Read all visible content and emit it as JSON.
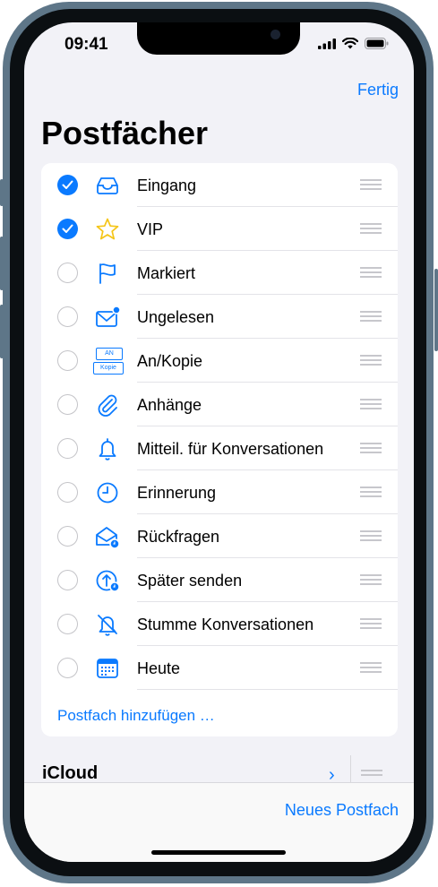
{
  "status_bar": {
    "time": "09:41"
  },
  "header": {
    "done_label": "Fertig",
    "title": "Postfächer"
  },
  "mailboxes": [
    {
      "label": "Eingang",
      "checked": true,
      "icon": "inbox-tray-icon"
    },
    {
      "label": "VIP",
      "checked": true,
      "icon": "star-icon"
    },
    {
      "label": "Markiert",
      "checked": false,
      "icon": "flag-icon"
    },
    {
      "label": "Ungelesen",
      "checked": false,
      "icon": "unread-envelope-icon"
    },
    {
      "label": "An/Kopie",
      "checked": false,
      "icon": "to-cc-icon",
      "icon_text": [
        "AN",
        "Kopie"
      ]
    },
    {
      "label": "Anhänge",
      "checked": false,
      "icon": "paperclip-icon"
    },
    {
      "label": "Mitteil. für Konversationen",
      "checked": false,
      "icon": "bell-icon"
    },
    {
      "label": "Erinnerung",
      "checked": false,
      "icon": "clock-icon"
    },
    {
      "label": "Rückfragen",
      "checked": false,
      "icon": "follow-up-envelope-icon"
    },
    {
      "label": "Später senden",
      "checked": false,
      "icon": "send-later-icon"
    },
    {
      "label": "Stumme Konversationen",
      "checked": false,
      "icon": "bell-slash-icon"
    },
    {
      "label": "Heute",
      "checked": false,
      "icon": "calendar-icon"
    }
  ],
  "add_mailbox_label": "Postfach hinzufügen …",
  "account_section": {
    "label": "iCloud"
  },
  "toolbar": {
    "new_mailbox_label": "Neues Postfach"
  },
  "colors": {
    "accent": "#0a7aff",
    "background": "#f2f2f7",
    "frame": "#5e7688"
  }
}
